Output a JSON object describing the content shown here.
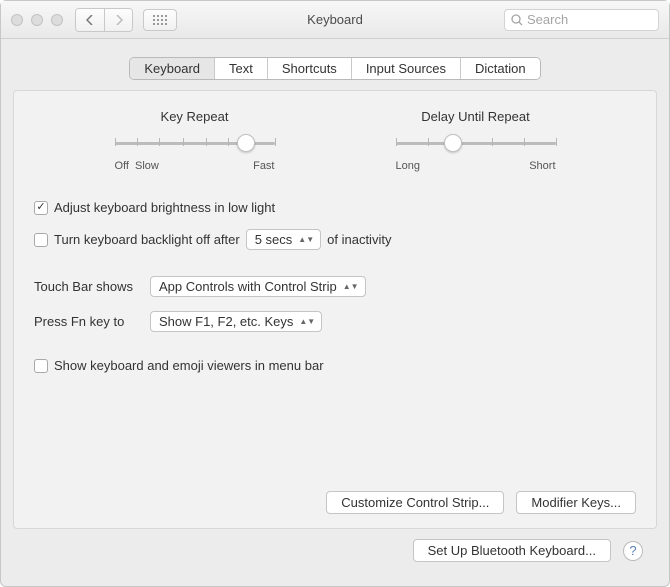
{
  "header": {
    "title": "Keyboard",
    "search_placeholder": "Search"
  },
  "tabs": [
    "Keyboard",
    "Text",
    "Shortcuts",
    "Input Sources",
    "Dictation"
  ],
  "active_tab": 0,
  "sliders": {
    "key_repeat": {
      "title": "Key Repeat",
      "left1": "Off",
      "left2": "Slow",
      "right": "Fast"
    },
    "delay": {
      "title": "Delay Until Repeat",
      "left": "Long",
      "right": "Short"
    }
  },
  "options": {
    "brightness_label": "Adjust keyboard brightness in low light",
    "backlight_off_pre": "Turn keyboard backlight off after",
    "backlight_off_value": "5 secs",
    "backlight_off_post": "of inactivity",
    "touch_bar_label": "Touch Bar shows",
    "touch_bar_value": "App Controls with Control Strip",
    "fn_label": "Press Fn key to",
    "fn_value": "Show F1, F2, etc. Keys",
    "emoji_label": "Show keyboard and emoji viewers in menu bar"
  },
  "buttons": {
    "customize": "Customize Control Strip...",
    "modifier": "Modifier Keys...",
    "bluetooth": "Set Up Bluetooth Keyboard..."
  }
}
